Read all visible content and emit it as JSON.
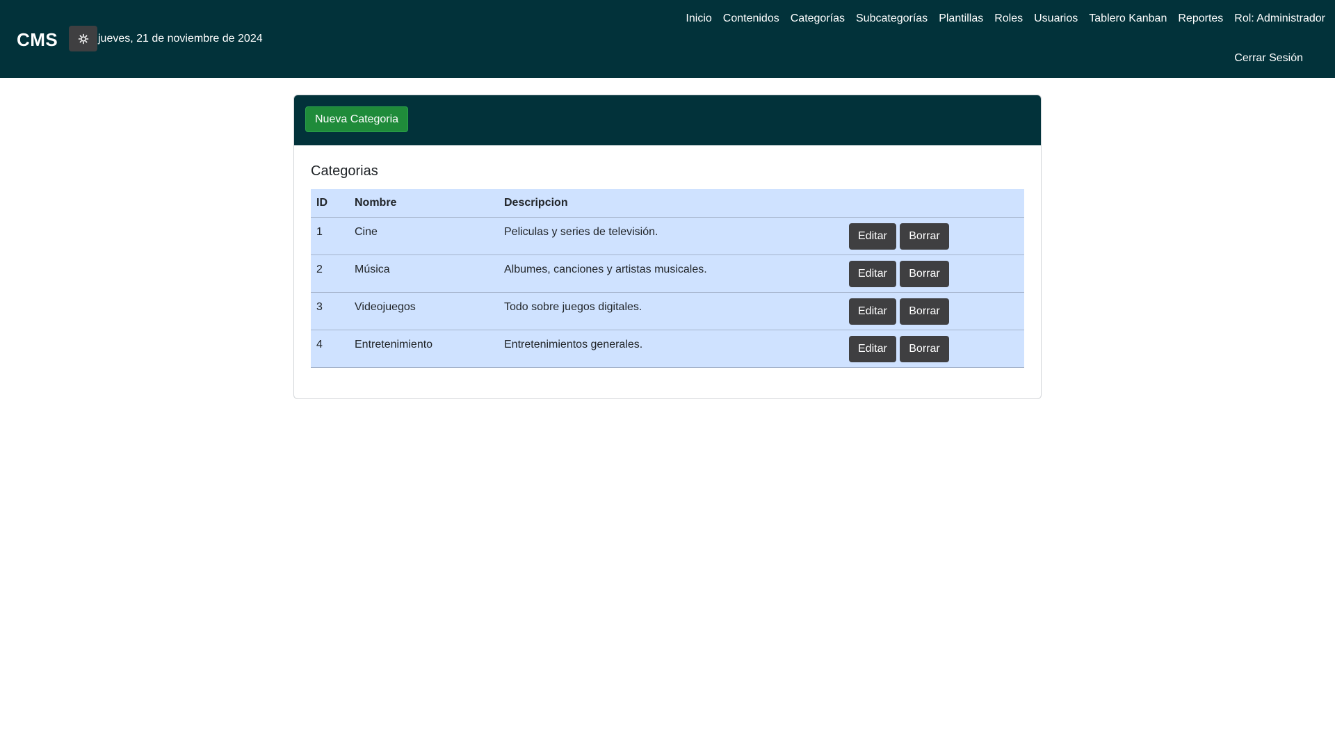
{
  "navbar": {
    "brand": "CMS",
    "date": "jueves, 21 de noviembre de 2024",
    "links": [
      "Inicio",
      "Contenidos",
      "Categorías",
      "Subcategorías",
      "Plantillas",
      "Roles",
      "Usuarios",
      "Tablero Kanban",
      "Reportes",
      "Rol: Administrador"
    ],
    "logout": "Cerrar Sesión"
  },
  "card": {
    "new_button": "Nueva Categoria",
    "title": "Categorias",
    "columns": [
      "ID",
      "Nombre",
      "Descripcion"
    ],
    "rows": [
      {
        "id": "1",
        "name": "Cine",
        "description": "Peliculas y series de televisión."
      },
      {
        "id": "2",
        "name": "Música",
        "description": "Albumes, canciones y artistas musicales."
      },
      {
        "id": "3",
        "name": "Videojuegos",
        "description": "Todo sobre juegos digitales."
      },
      {
        "id": "4",
        "name": "Entretenimiento",
        "description": "Entretenimientos generales."
      }
    ],
    "edit_label": "Editar",
    "delete_label": "Borrar"
  },
  "colors": {
    "navbar_bg": "#02323a",
    "table_bg": "#cfe2ff",
    "success": "#1f8b3a",
    "button_dark": "#3f3f41"
  }
}
